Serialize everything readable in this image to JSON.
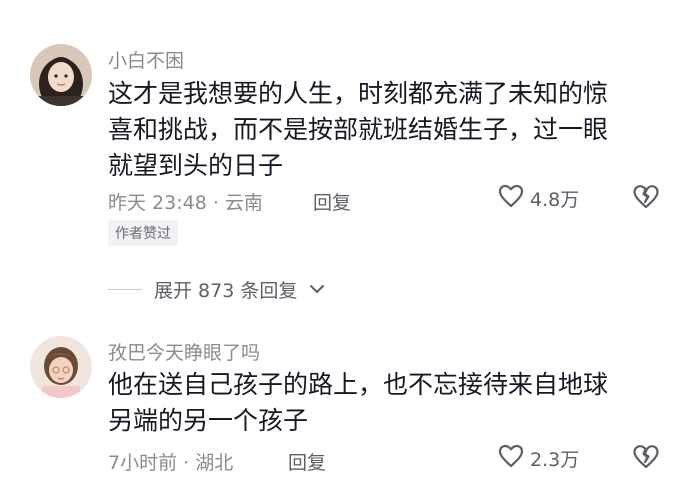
{
  "comments": [
    {
      "username": "小白不困",
      "lines": [
        "这才是我想要的人生，时刻都充满了未知的惊",
        "喜和挑战，而不是按部就班结婚生子，过一眼",
        "就望到头的日子"
      ],
      "meta": "昨天 23:48 · 云南",
      "reply_label": "回复",
      "like_count": "4.8万",
      "author_badge": "作者赞过"
    },
    {
      "username": "孜巴今天睁眼了吗",
      "lines": [
        "他在送自己孩子的路上，也不忘接待来自地球",
        "另端的另一个孩子"
      ],
      "meta": "7小时前 · 湖北",
      "reply_label": "回复",
      "like_count": "2.3万"
    }
  ],
  "expand_replies": {
    "label": "展开 873 条回复"
  },
  "icons": {
    "like": "heart-outline-icon",
    "dislike": "broken-heart-icon",
    "expand": "chevron-down-icon"
  },
  "colors": {
    "text_primary": "#161823",
    "text_secondary": "#8a8b91",
    "action_gray": "#5d5f67",
    "badge_bg": "#f2f2f4"
  }
}
